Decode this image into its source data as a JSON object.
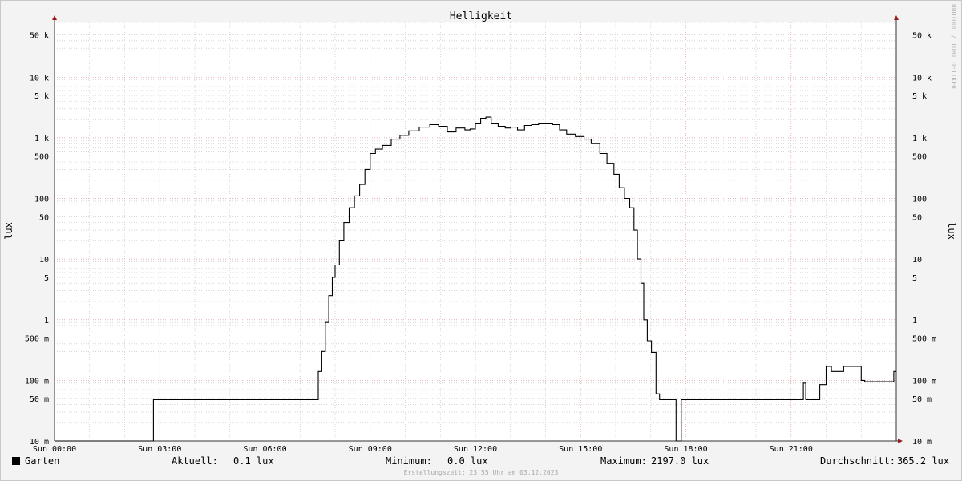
{
  "chart_data": {
    "type": "line",
    "title": "Helligkeit",
    "ylabel": "lux",
    "y_scale": "log",
    "ylim": [
      0.01,
      80000
    ],
    "xlim": [
      0,
      24
    ],
    "grid": true,
    "x_ticks": [
      {
        "x": 0,
        "label": "Sun 00:00"
      },
      {
        "x": 3,
        "label": "Sun 03:00"
      },
      {
        "x": 6,
        "label": "Sun 06:00"
      },
      {
        "x": 9,
        "label": "Sun 09:00"
      },
      {
        "x": 12,
        "label": "Sun 12:00"
      },
      {
        "x": 15,
        "label": "Sun 15:00"
      },
      {
        "x": 18,
        "label": "Sun 18:00"
      },
      {
        "x": 21,
        "label": "Sun 21:00"
      }
    ],
    "y_ticks": [
      {
        "v": 0.01,
        "label": "10 m"
      },
      {
        "v": 0.05,
        "label": "50 m"
      },
      {
        "v": 0.1,
        "label": "100 m"
      },
      {
        "v": 0.5,
        "label": "500 m"
      },
      {
        "v": 1,
        "label": "1"
      },
      {
        "v": 5,
        "label": "5"
      },
      {
        "v": 10,
        "label": "10"
      },
      {
        "v": 50,
        "label": "50"
      },
      {
        "v": 100,
        "label": "100"
      },
      {
        "v": 500,
        "label": "500"
      },
      {
        "v": 1000,
        "label": "1 k"
      },
      {
        "v": 5000,
        "label": "5 k"
      },
      {
        "v": 10000,
        "label": "10 k"
      },
      {
        "v": 50000,
        "label": "50 k"
      }
    ],
    "series": [
      {
        "name": "Garten",
        "color": "#000000",
        "points": [
          [
            0.0,
            0.01
          ],
          [
            2.8,
            0.01
          ],
          [
            2.82,
            0.048
          ],
          [
            7.5,
            0.048
          ],
          [
            7.52,
            0.14
          ],
          [
            7.62,
            0.3
          ],
          [
            7.72,
            0.9
          ],
          [
            7.82,
            2.5
          ],
          [
            7.92,
            5
          ],
          [
            8.0,
            8
          ],
          [
            8.12,
            20
          ],
          [
            8.25,
            40
          ],
          [
            8.4,
            70
          ],
          [
            8.55,
            110
          ],
          [
            8.7,
            170
          ],
          [
            8.85,
            300
          ],
          [
            9.0,
            550
          ],
          [
            9.15,
            650
          ],
          [
            9.35,
            750
          ],
          [
            9.6,
            950
          ],
          [
            9.85,
            1100
          ],
          [
            10.1,
            1300
          ],
          [
            10.4,
            1500
          ],
          [
            10.7,
            1650
          ],
          [
            10.95,
            1550
          ],
          [
            11.2,
            1250
          ],
          [
            11.45,
            1450
          ],
          [
            11.7,
            1350
          ],
          [
            11.85,
            1400
          ],
          [
            12.0,
            1700
          ],
          [
            12.15,
            2100
          ],
          [
            12.3,
            2197
          ],
          [
            12.45,
            1700
          ],
          [
            12.65,
            1550
          ],
          [
            12.85,
            1450
          ],
          [
            13.0,
            1500
          ],
          [
            13.2,
            1350
          ],
          [
            13.4,
            1600
          ],
          [
            13.6,
            1650
          ],
          [
            13.8,
            1700
          ],
          [
            14.0,
            1700
          ],
          [
            14.2,
            1650
          ],
          [
            14.4,
            1350
          ],
          [
            14.6,
            1150
          ],
          [
            14.85,
            1050
          ],
          [
            15.1,
            950
          ],
          [
            15.3,
            800
          ],
          [
            15.55,
            550
          ],
          [
            15.75,
            380
          ],
          [
            15.95,
            250
          ],
          [
            16.1,
            150
          ],
          [
            16.25,
            100
          ],
          [
            16.4,
            70
          ],
          [
            16.52,
            30
          ],
          [
            16.62,
            10
          ],
          [
            16.72,
            4
          ],
          [
            16.8,
            1
          ],
          [
            16.9,
            0.45
          ],
          [
            17.02,
            0.29
          ],
          [
            17.15,
            0.06
          ],
          [
            17.25,
            0.048
          ],
          [
            17.7,
            0.048
          ],
          [
            17.72,
            0.01
          ],
          [
            17.85,
            0.01
          ],
          [
            17.87,
            0.048
          ],
          [
            21.3,
            0.048
          ],
          [
            21.35,
            0.09
          ],
          [
            21.42,
            0.048
          ],
          [
            21.8,
            0.048
          ],
          [
            21.82,
            0.085
          ],
          [
            21.95,
            0.085
          ],
          [
            22.0,
            0.17
          ],
          [
            22.15,
            0.14
          ],
          [
            22.45,
            0.14
          ],
          [
            22.5,
            0.17
          ],
          [
            22.95,
            0.17
          ],
          [
            23.0,
            0.1
          ],
          [
            23.1,
            0.095
          ],
          [
            23.9,
            0.095
          ],
          [
            23.93,
            0.14
          ],
          [
            24.0,
            0.14
          ]
        ]
      }
    ],
    "legend": {
      "label": "Garten",
      "stats": [
        {
          "label": "Aktuell:",
          "value": "0.1 lux"
        },
        {
          "label": "Minimum:",
          "value": "0.0 lux"
        },
        {
          "label": "Maximum:",
          "value": "2197.0 lux"
        },
        {
          "label": "Durchschnitt:",
          "value": "365.2 lux"
        }
      ]
    },
    "watermark": "RRDTOOL / TOBI OETIKER",
    "footer": "Erstellungszeit: 23:55 Uhr am 03.12.2023"
  },
  "colors": {
    "background": "#f3f3f3",
    "canvas": "#ffffff",
    "major_grid": "#e59a9a",
    "minor_grid": "#bdbdbd",
    "axis": "#333333",
    "arrow": "#9b1b1b"
  }
}
